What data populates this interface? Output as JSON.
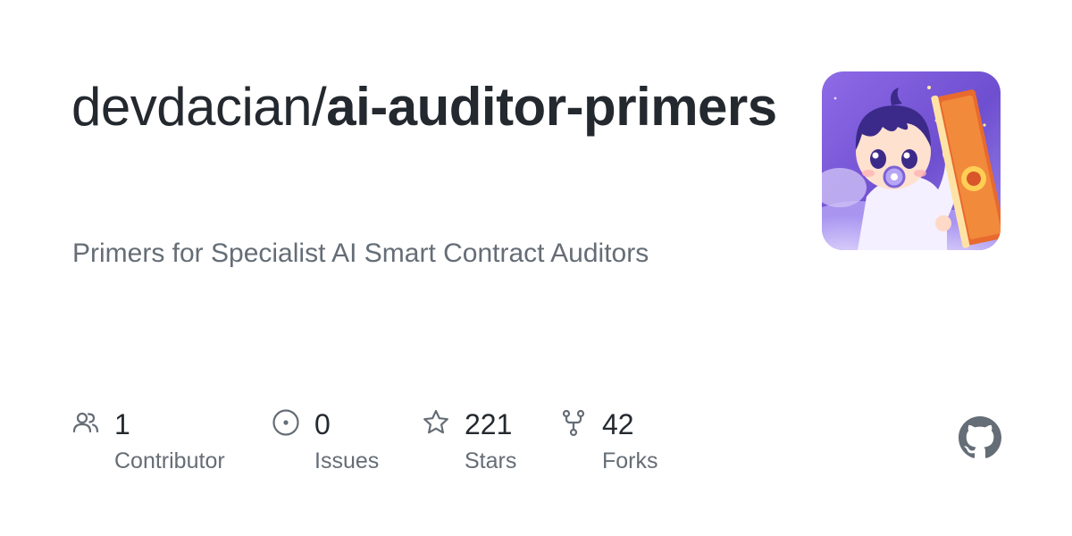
{
  "repo": {
    "owner": "devdacian/",
    "name": "ai-auditor-primers",
    "description": "Primers for Specialist AI Smart Contract Auditors"
  },
  "stats": [
    {
      "icon": "people-icon",
      "value": "1",
      "label": "Contributor"
    },
    {
      "icon": "issue-icon",
      "value": "0",
      "label": "Issues"
    },
    {
      "icon": "star-icon",
      "value": "221",
      "label": "Stars"
    },
    {
      "icon": "fork-icon",
      "value": "42",
      "label": "Forks"
    }
  ],
  "avatar": {
    "icon": "anime-baby-reading-avatar"
  },
  "brand": {
    "icon": "github-mark-icon"
  },
  "colors": {
    "text_primary": "#24292f",
    "text_secondary": "#656d76",
    "icon": "#656d76",
    "avatar_bg": "#7b5cd6"
  }
}
